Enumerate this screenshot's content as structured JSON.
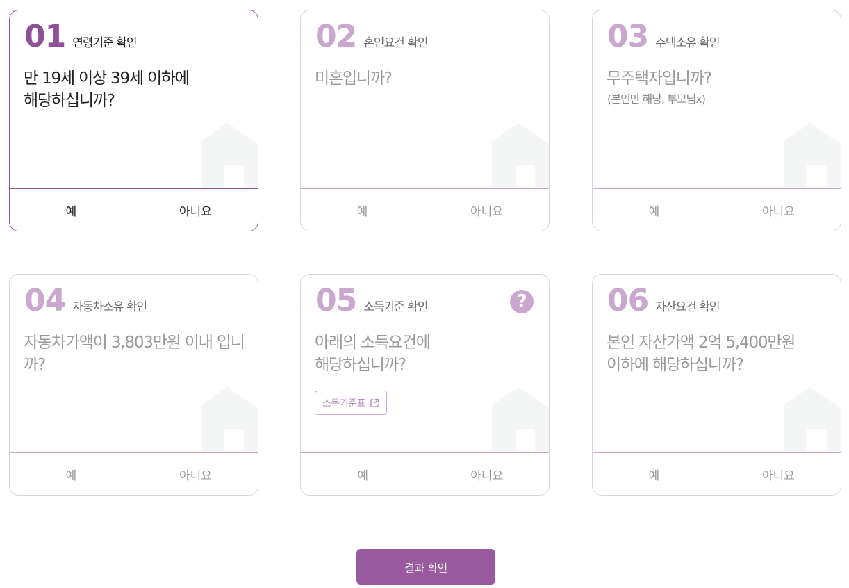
{
  "cards": [
    {
      "num": "01",
      "title": "연령기준 확인",
      "question": [
        "만 19세 이상 39세 이하에",
        "해당하십니까?"
      ],
      "yes": "예",
      "no": "아니요"
    },
    {
      "num": "02",
      "title": "혼인요건 확인",
      "question": [
        "미혼입니까?"
      ],
      "yes": "예",
      "no": "아니요"
    },
    {
      "num": "03",
      "title": "주택소유 확인",
      "question": [
        "무주택자입니까?"
      ],
      "sub": "(본인만 해당, 부모님x)",
      "yes": "예",
      "no": "아니요"
    },
    {
      "num": "04",
      "title": "자동차소유 확인",
      "question": [
        "자동차가액이 3,803만원 이내 입니",
        "까?"
      ],
      "yes": "예",
      "no": "아니요"
    },
    {
      "num": "05",
      "title": "소득기준 확인",
      "question": [
        "아래의 소득요건에",
        "해당하십니까?"
      ],
      "help_icon": "?",
      "link_label": "소득기준표",
      "yes": "예",
      "no": "아니요"
    },
    {
      "num": "06",
      "title": "자산요건 확인",
      "question": [
        "본인 자산가액 2억 5,400만원",
        "이하에 해당하십니까?"
      ],
      "yes": "예",
      "no": "아니요"
    }
  ],
  "result_button": "결과 확인",
  "icons": {
    "house": "house-icon",
    "help": "question-circle-icon",
    "external": "external-link-icon"
  },
  "colors": {
    "accent": "#98599f",
    "accent_light": "#c9a7cf",
    "border": "#d6d6d6",
    "house": "#f4f5f5"
  }
}
